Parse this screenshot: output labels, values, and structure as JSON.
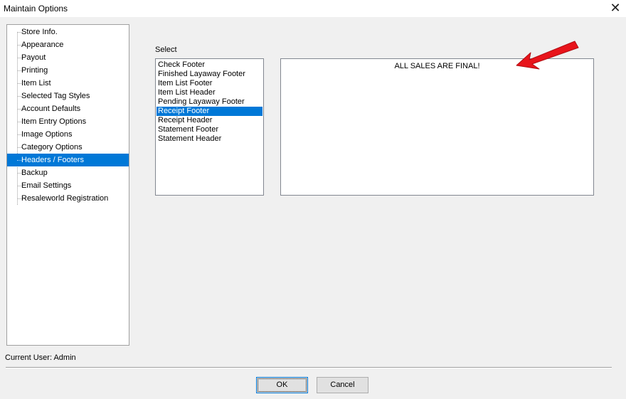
{
  "window": {
    "title": "Maintain Options",
    "close_glyph": "✕"
  },
  "sidebar": {
    "items": [
      {
        "label": "Store Info."
      },
      {
        "label": "Appearance"
      },
      {
        "label": "Payout"
      },
      {
        "label": "Printing"
      },
      {
        "label": "Item List"
      },
      {
        "label": "Selected Tag Styles"
      },
      {
        "label": "Account Defaults"
      },
      {
        "label": "Item Entry Options"
      },
      {
        "label": "Image Options"
      },
      {
        "label": "Category Options"
      },
      {
        "label": "Headers / Footers"
      },
      {
        "label": "Backup"
      },
      {
        "label": "Email Settings"
      },
      {
        "label": "Resaleworld Registration"
      }
    ],
    "selected": "Headers / Footers"
  },
  "main": {
    "select_label": "Select",
    "list_items": [
      {
        "label": "Check Footer"
      },
      {
        "label": "Finished Layaway Footer"
      },
      {
        "label": "Item List Footer"
      },
      {
        "label": "Item List Header"
      },
      {
        "label": "Pending Layaway Footer"
      },
      {
        "label": "Receipt Footer"
      },
      {
        "label": "Receipt Header"
      },
      {
        "label": "Statement Footer"
      },
      {
        "label": "Statement Header"
      }
    ],
    "selected_item": "Receipt Footer",
    "text_content": "ALL SALES ARE FINAL!"
  },
  "status": {
    "current_user": "Current User: Admin"
  },
  "buttons": {
    "ok": "OK",
    "cancel": "Cancel"
  },
  "colors": {
    "selection": "#0078d7",
    "arrow": "#e8141b",
    "background": "#f0f0f0"
  },
  "annotation": {
    "icon": "red-arrow-icon"
  }
}
